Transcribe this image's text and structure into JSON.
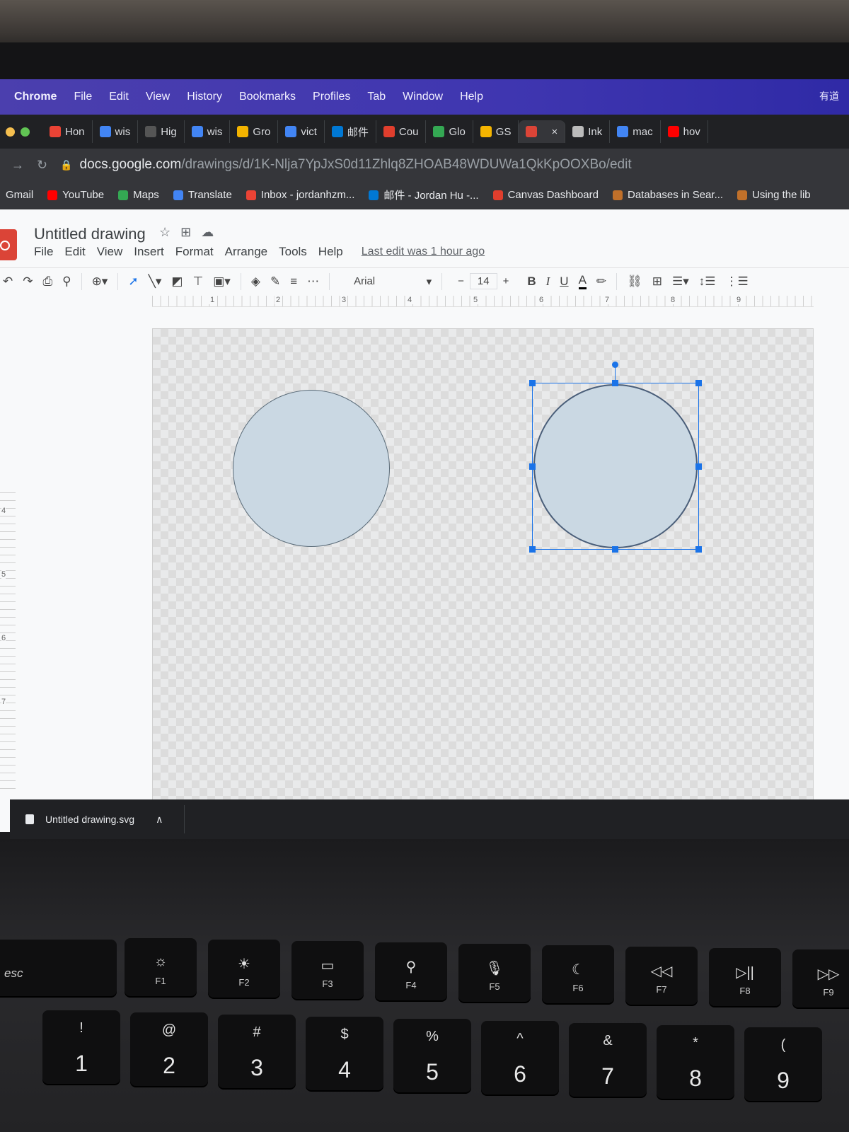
{
  "menubar": {
    "items": [
      "Chrome",
      "File",
      "Edit",
      "View",
      "History",
      "Bookmarks",
      "Profiles",
      "Tab",
      "Window",
      "Help"
    ],
    "right_text": "有道"
  },
  "tabs": [
    {
      "label": "Hon",
      "fav": "gmail-icon",
      "color": "#ea4335"
    },
    {
      "label": "wis",
      "fav": "google-icon",
      "color": "#4285f4"
    },
    {
      "label": "Hig",
      "fav": "wikipedia-icon",
      "color": "#555555"
    },
    {
      "label": "wis",
      "fav": "google-icon",
      "color": "#4285f4"
    },
    {
      "label": "Gro",
      "fav": "slides-icon",
      "color": "#f4b400"
    },
    {
      "label": "vict",
      "fav": "chart-icon",
      "color": "#4285f4"
    },
    {
      "label": "邮件",
      "fav": "outlook-icon",
      "color": "#0078d4"
    },
    {
      "label": "Cou",
      "fav": "canvas-icon",
      "color": "#e03e2d"
    },
    {
      "label": "Glo",
      "fav": "location-icon",
      "color": "#34a853"
    },
    {
      "label": "GS",
      "fav": "slides-icon",
      "color": "#f4b400"
    },
    {
      "label": "",
      "fav": "drawings-icon",
      "color": "#db4437",
      "active": true
    },
    {
      "label": "Ink",
      "fav": "inkscape-icon",
      "color": "#bbbbbb"
    },
    {
      "label": "mac",
      "fav": "google-icon",
      "color": "#4285f4"
    },
    {
      "label": "hov",
      "fav": "youtube-icon",
      "color": "#ff0000"
    }
  ],
  "address": {
    "host": "docs.google.com",
    "path": "/drawings/d/1K-Nlja7YpJxS0d11Zhlq8ZHOAB48WDUWa1QkKpOOXBo/edit"
  },
  "bookmarks": [
    {
      "label": "Gmail",
      "color": "transparent"
    },
    {
      "label": "YouTube",
      "color": "#ff0000"
    },
    {
      "label": "Maps",
      "color": "#34a853"
    },
    {
      "label": "Translate",
      "color": "#4285f4"
    },
    {
      "label": "Inbox - jordanhzm...",
      "color": "#ea4335"
    },
    {
      "label": "邮件 - Jordan Hu -...",
      "color": "#0078d4"
    },
    {
      "label": "Canvas Dashboard",
      "color": "#e03e2d"
    },
    {
      "label": "Databases in Sear...",
      "color": "#c0702a"
    },
    {
      "label": "Using the lib",
      "color": "#c0702a"
    }
  ],
  "doc": {
    "title": "Untitled drawing",
    "menu": [
      "File",
      "Edit",
      "View",
      "Insert",
      "Format",
      "Arrange",
      "Tools",
      "Help"
    ],
    "last_edit": "Last edit was 1 hour ago"
  },
  "toolbar": {
    "font": "Arial",
    "font_size": "14",
    "minus": "−",
    "plus": "+",
    "bold": "B",
    "italic": "I",
    "underline": "U",
    "text_color": "A"
  },
  "ruler": {
    "h": [
      "1",
      "2",
      "3",
      "4",
      "5",
      "6",
      "7",
      "8",
      "9"
    ],
    "v": [
      "4",
      "5",
      "6",
      "7"
    ]
  },
  "download": {
    "filename": "Untitled drawing.svg"
  },
  "keyboard": {
    "esc": "esc",
    "fkeys": [
      {
        "label": "F1",
        "icon": "☼"
      },
      {
        "label": "F2",
        "icon": "☀"
      },
      {
        "label": "F3",
        "icon": "▭"
      },
      {
        "label": "F4",
        "icon": "⚲"
      },
      {
        "label": "F5",
        "icon": "🎙"
      },
      {
        "label": "F6",
        "icon": "☾"
      },
      {
        "label": "F7",
        "icon": "◁◁"
      },
      {
        "label": "F8",
        "icon": "▷||"
      },
      {
        "label": "F9",
        "icon": "▷▷"
      }
    ],
    "numkeys": [
      {
        "top": "!",
        "bot": "1"
      },
      {
        "top": "@",
        "bot": "2"
      },
      {
        "top": "#",
        "bot": "3"
      },
      {
        "top": "$",
        "bot": "4"
      },
      {
        "top": "%",
        "bot": "5"
      },
      {
        "top": "^",
        "bot": "6"
      },
      {
        "top": "&",
        "bot": "7"
      },
      {
        "top": "*",
        "bot": "8"
      },
      {
        "top": "(",
        "bot": "9"
      }
    ]
  }
}
